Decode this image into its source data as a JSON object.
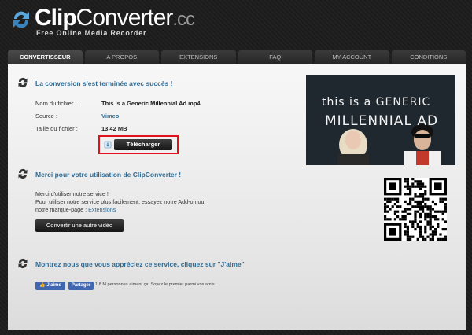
{
  "logo": {
    "part1": "Clip",
    "part2": "Converter",
    "part3": ".cc",
    "tagline": "Free Online Media Recorder"
  },
  "nav": {
    "tabs": [
      {
        "label": "CONVERTISSEUR",
        "active": true
      },
      {
        "label": "A PROPOS",
        "active": false
      },
      {
        "label": "EXTENSIONS",
        "active": false
      },
      {
        "label": "FAQ",
        "active": false
      },
      {
        "label": "MY ACCOUNT",
        "active": false
      },
      {
        "label": "CONDITIONS",
        "active": false
      }
    ]
  },
  "result": {
    "title": "La conversion s'est terminée avec succès !",
    "filename_label": "Nom du fichier :",
    "filename_value": "This Is a Generic Millennial Ad.mp4",
    "source_label": "Source :",
    "source_value": "Vimeo",
    "size_label": "Taille du fichier :",
    "size_value": "13.42 MB",
    "download_label": "Télécharger"
  },
  "thumbnail": {
    "line1": "this is a GENERIC",
    "line2": "MILLENNIAL AD"
  },
  "thanks": {
    "title": "Merci pour votre utilisation de ClipConverter !",
    "line1": "Merci d'utiliser notre service !",
    "line2": "Pour utiliser notre service plus facilement, essayez notre Add-on ou",
    "line3_prefix": "notre marque-page : ",
    "line3_link": "Extensions",
    "convert_other": "Convertir une autre vidéo"
  },
  "like": {
    "title": "Montrez nous que vous appréciez ce service, cliquez sur \"J'aime\"",
    "like_label": "J'aime",
    "share_label": "Partager",
    "social_text": "1,8 M personnes aiment ça. Soyez le premier parmi vos amis."
  },
  "colors": {
    "accent": "#2f6d97",
    "highlight_border": "#e0121a",
    "facebook": "#4267b2"
  }
}
